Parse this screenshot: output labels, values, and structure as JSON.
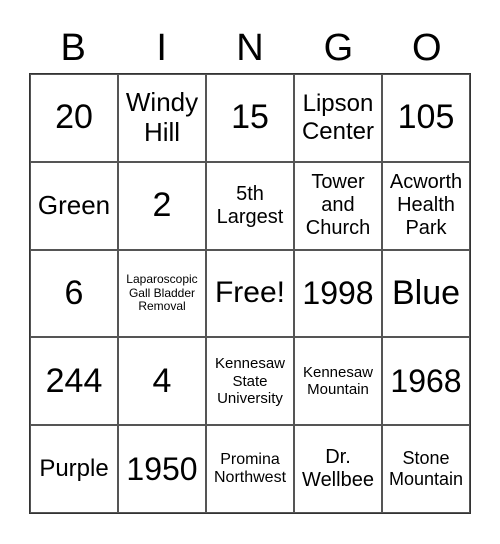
{
  "header": [
    "B",
    "I",
    "N",
    "G",
    "O"
  ],
  "cells": [
    "20",
    "Windy\nHill",
    "15",
    "Lipson\nCenter",
    "105",
    "Green",
    "2",
    "5th\nLargest",
    "Tower\nand\nChurch",
    "Acworth\nHealth\nPark",
    "6",
    "Laparoscopic\nGall Bladder\nRemoval",
    "Free!",
    "1998",
    "Blue",
    "244",
    "4",
    "Kennesaw\nState\nUniversity",
    "Kennesaw\nMountain",
    "1968",
    "Purple",
    "1950",
    "Promina\nNorthwest",
    "Dr.\nWellbee",
    "Stone\nMountain"
  ]
}
